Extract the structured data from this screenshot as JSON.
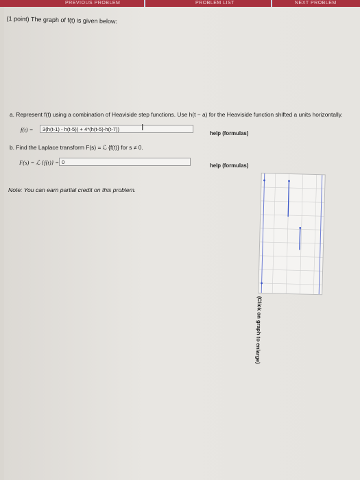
{
  "header": {
    "tabs": [
      "PREVIOUS PROBLEM",
      "PROBLEM LIST",
      "NEXT PROBLEM"
    ]
  },
  "problem": {
    "intro": "(1 point) The graph of f(t) is given below:",
    "graph_caption": "(Click on graph to enlarge)",
    "part_a": {
      "label": "a. Represent f(t) using a combination of Heaviside step functions. Use h(t − a) for the Heaviside function shifted a units horizontally.",
      "lhs": "f(t) =",
      "value": "3(h(t-1) - h(t-5)) + 4*(h(t-5)-h(t-7))",
      "help": "help (formulas)"
    },
    "part_b": {
      "label": "b. Find the Laplace transform F(s) = ℒ {f(t)} for s ≠ 0.",
      "lhs": "F(s) = ℒ {f(t)} =",
      "value": "0",
      "help": "help (formulas)"
    },
    "note": "Note: You can earn partial credit on this problem."
  },
  "colors": {
    "header_bar": "#a8313e",
    "graph_line": "#3b57c8",
    "grid": "#c9c9c9"
  }
}
